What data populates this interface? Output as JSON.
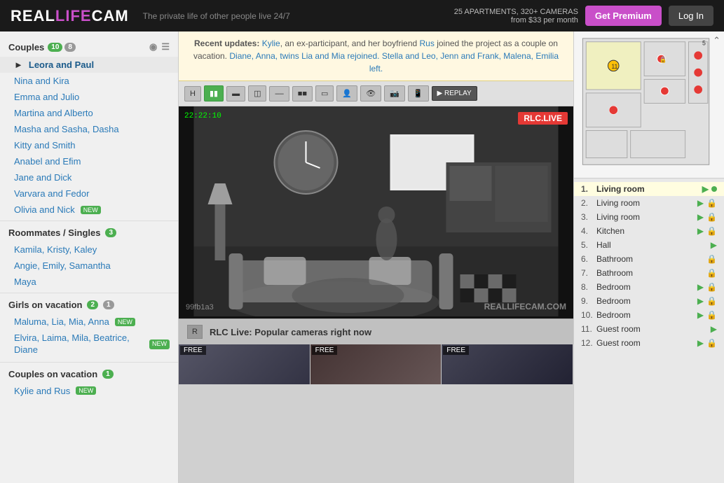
{
  "header": {
    "logo": "REALLIFECAM",
    "tagline": "The private life of other people live 24/7",
    "apartments": "25 APARTMENTS, 320+ CAMERAS",
    "price": "from $33 per month",
    "btn_premium": "Get Premium",
    "btn_login": "Log In"
  },
  "notice": {
    "text1": "Recent updates:",
    "kylie": "Kylie",
    "text2": ", an ex-participant, and her boyfriend",
    "rus": "Rus",
    "text3": " joined the project as a couple on vacation.",
    "text4": " Diane, Anna, twins Lia and Mia rejoined.",
    "text5": " Stella and Leo, Jenn and Frank, Malena, Emilia left."
  },
  "sidebar": {
    "couples_label": "Couples",
    "couples_count": "10",
    "couples_count2": "8",
    "items": [
      {
        "label": "Leora and Paul",
        "active": true
      },
      {
        "label": "Nina and Kira"
      },
      {
        "label": "Emma and Julio"
      },
      {
        "label": "Martina and Alberto"
      },
      {
        "label": "Masha and Sasha, Dasha"
      },
      {
        "label": "Kitty and Smith"
      },
      {
        "label": "Anabel and Efim"
      },
      {
        "label": "Jane and Dick"
      },
      {
        "label": "Varvara and Fedor"
      },
      {
        "label": "Olivia and Nick",
        "new": true
      }
    ],
    "roommates_label": "Roommates / Singles",
    "roommates_count": "3",
    "roommates": [
      {
        "label": "Kamila, Kristy, Kaley"
      },
      {
        "label": "Angie, Emily, Samantha"
      },
      {
        "label": "Maya"
      }
    ],
    "girls_label": "Girls on vacation",
    "girls_count": "2",
    "girls_count2": "1",
    "girls": [
      {
        "label": "Maluma, Lia, Mia, Anna",
        "new": true
      },
      {
        "label": "Elvira, Laima, Mila, Beatrice, Diane",
        "new": true
      }
    ],
    "couples_vac_label": "Couples on vacation",
    "couples_vac_count": "1",
    "couples_vac": [
      {
        "label": "Kylie and Rus",
        "new": true
      }
    ]
  },
  "camera": {
    "timestamp": "22:22:10",
    "live_badge": "RLC.LIVE",
    "watermark": "REALLIFECAM.COM",
    "id": "99fb1a3"
  },
  "controls": {
    "h_btn": "H",
    "replay": "REPLAY"
  },
  "rooms": [
    {
      "num": "1.",
      "name": "Living room",
      "sound": true,
      "active": true
    },
    {
      "num": "2.",
      "name": "Living room",
      "sound": true,
      "lock": true
    },
    {
      "num": "3.",
      "name": "Living room",
      "sound": true,
      "lock": true
    },
    {
      "num": "4.",
      "name": "Kitchen",
      "sound": true,
      "lock": true
    },
    {
      "num": "5.",
      "name": "Hall",
      "sound": true
    },
    {
      "num": "6.",
      "name": "Bathroom",
      "lock": true
    },
    {
      "num": "7.",
      "name": "Bathroom",
      "lock": true
    },
    {
      "num": "8.",
      "name": "Bedroom",
      "sound": true,
      "lock": true
    },
    {
      "num": "9.",
      "name": "Bedroom",
      "sound": true,
      "lock": true
    },
    {
      "num": "10.",
      "name": "Bedroom",
      "sound": true,
      "lock": true
    },
    {
      "num": "11.",
      "name": "Guest room",
      "sound": true
    },
    {
      "num": "12.",
      "name": "Guest room",
      "sound": true,
      "lock": true
    }
  ],
  "popular": {
    "label": "RLC Live: Popular cameras right now"
  },
  "thumbnails": [
    {
      "label": "FREE"
    },
    {
      "label": "FREE"
    },
    {
      "label": "FREE"
    }
  ]
}
